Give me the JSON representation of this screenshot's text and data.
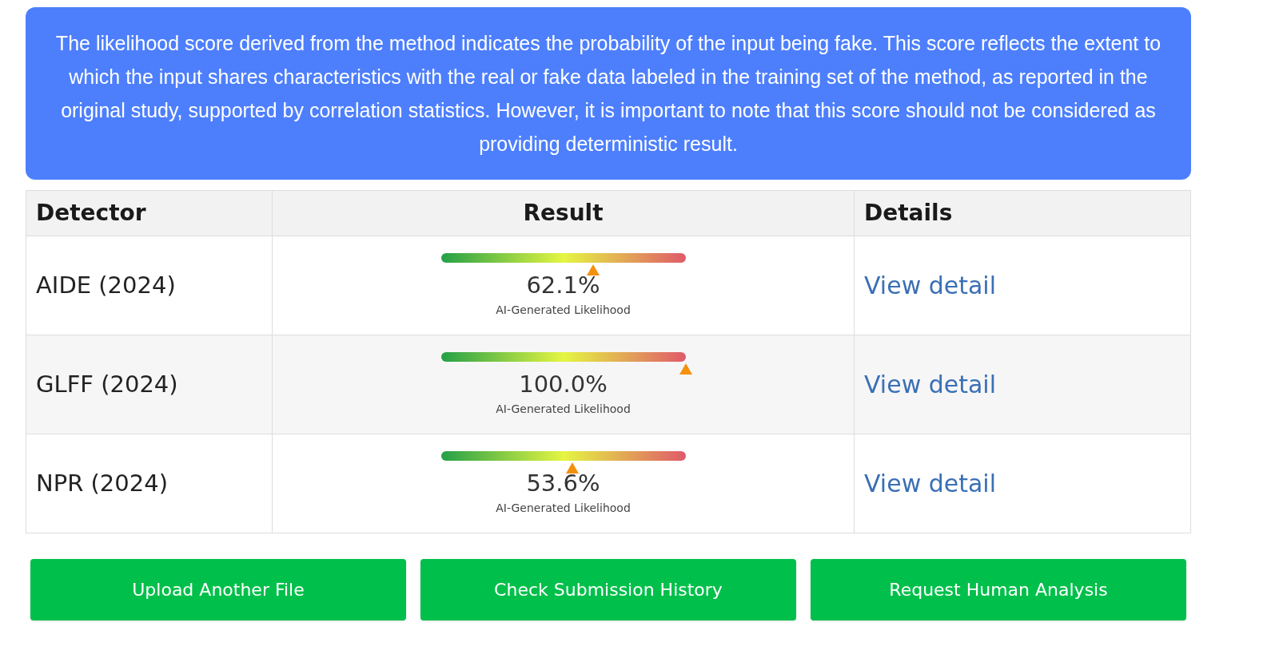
{
  "notice": "The likelihood score derived from the method indicates the probability of the input being fake. This score reflects the extent to which the input shares characteristics with the real or fake data labeled in the training set of the method, as reported in the original study, supported by correlation statistics. However, it is important to note that this score should not be considered as providing deterministic result.",
  "table": {
    "columns": [
      "Detector",
      "Result",
      "Details"
    ],
    "rows": [
      {
        "detector": "AIDE (2024)",
        "level": 0.621,
        "score": "62.1%",
        "caption": "AI-Generated Likelihood",
        "link": "View detail"
      },
      {
        "detector": "GLFF (2024)",
        "level": 1.0,
        "score": "100.0%",
        "caption": "AI-Generated Likelihood",
        "link": "View detail"
      },
      {
        "detector": "NPR (2024)",
        "level": 0.536,
        "score": "53.6%",
        "caption": "AI-Generated Likelihood",
        "link": "View detail"
      }
    ]
  },
  "buttons": [
    "Upload Another File",
    "Check Submission History",
    "Request Human Analysis"
  ]
}
